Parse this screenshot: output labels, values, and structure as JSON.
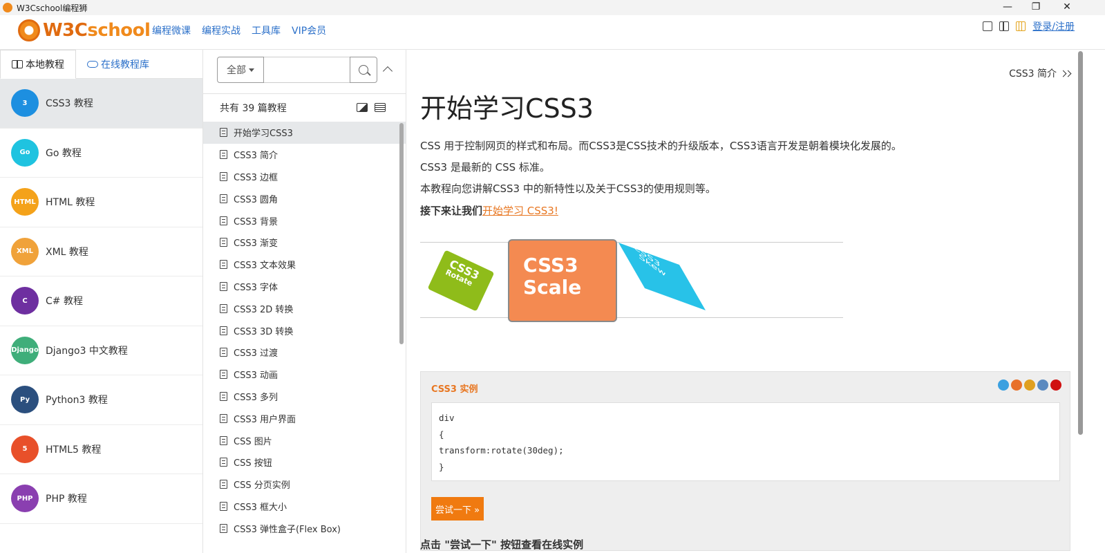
{
  "window": {
    "title": "W3Cschool编程狮",
    "controls": [
      "—",
      "❐",
      "✕"
    ]
  },
  "header": {
    "logo_w3c": "W3C",
    "logo_school": "school",
    "nav": [
      "编程微课",
      "编程实战",
      "工具库",
      "VIP会员"
    ],
    "login": "登录/注册"
  },
  "left": {
    "tabs": [
      "本地教程",
      "在线教程库"
    ],
    "courses": [
      {
        "label": "CSS3 教程",
        "icon": "css3-icon",
        "color": "#1d8fe0",
        "glyph": "3"
      },
      {
        "label": "Go 教程",
        "icon": "go-icon",
        "color": "#1fc3e0",
        "glyph": "Go"
      },
      {
        "label": "HTML 教程",
        "icon": "html-icon",
        "color": "#f4a21a",
        "glyph": "HTML"
      },
      {
        "label": "XML 教程",
        "icon": "xml-icon",
        "color": "#f0a23a",
        "glyph": "XML"
      },
      {
        "label": "C# 教程",
        "icon": "csharp-icon",
        "color": "#6e2fa0",
        "glyph": "C"
      },
      {
        "label": "Django3 中文教程",
        "icon": "django-icon",
        "color": "#3fae7a",
        "glyph": "Django"
      },
      {
        "label": "Python3 教程",
        "icon": "python-icon",
        "color": "#2b4f7e",
        "glyph": "Py"
      },
      {
        "label": "HTML5 教程",
        "icon": "html5-icon",
        "color": "#e8502a",
        "glyph": "5"
      },
      {
        "label": "PHP 教程",
        "icon": "php-icon",
        "color": "#8a3fb0",
        "glyph": "PHP"
      }
    ]
  },
  "middle": {
    "filter": "全部",
    "search_placeholder": "",
    "count": "共有 39 篇教程",
    "lessons": [
      "开始学习CSS3",
      "CSS3 简介",
      "CSS3 边框",
      "CSS3 圆角",
      "CSS3 背景",
      "CSS3 渐变",
      "CSS3 文本效果",
      "CSS3 字体",
      "CSS3 2D 转换",
      "CSS3 3D 转换",
      "CSS3 过渡",
      "CSS3 动画",
      "CSS3 多列",
      "CSS3 用户界面",
      "CSS 图片",
      "CSS 按钮",
      "CSS 分页实例",
      "CSS3 框大小",
      "CSS3 弹性盒子(Flex Box)"
    ]
  },
  "content": {
    "breadcrumb_next": "CSS3 简介",
    "title": "开始学习CSS3",
    "p1": "CSS 用于控制网页的样式和布局。而CSS3是CSS技术的升级版本，CSS3语言开发是朝着模块化发展的。",
    "p2": "CSS3 是最新的 CSS 标准。",
    "p3": "本教程向您讲解CSS3 中的新特性以及关于CSS3的使用规则等。",
    "p4_bold": "接下来让我们",
    "p4_link": "开始学习 CSS3!",
    "demo": {
      "rotate_main": "CSS3",
      "rotate_sub": "Rotate",
      "scale_main": "CSS3",
      "scale_sub": "Scale",
      "skew_main": "CSS3",
      "skew_sub": "Skew"
    },
    "example_title": "CSS3 实例",
    "browsers": [
      "#3aa0e0",
      "#e8702a",
      "#e0a020",
      "#5a8ac0",
      "#d01010"
    ],
    "code_lines": [
      "div",
      "{",
      "transform:rotate(30deg);",
      "}"
    ],
    "try_button": "尝试一下 »",
    "after_text": "点击 \"尝试一下\" 按钮查看在线实例"
  }
}
